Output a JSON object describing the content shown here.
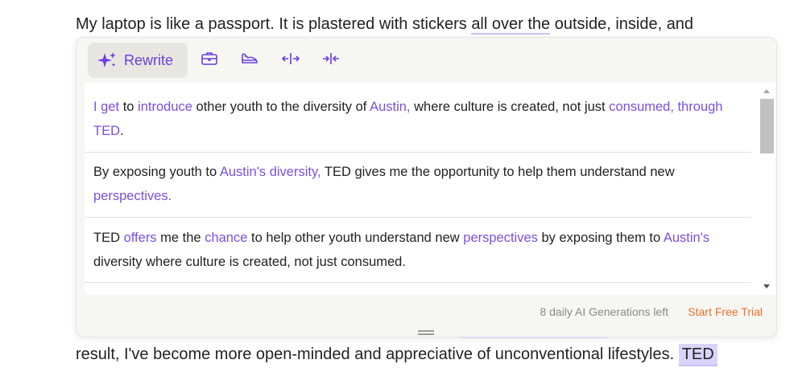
{
  "document": {
    "top_line": {
      "part1": "My laptop is like a passport. It is plastered with stickers ",
      "highlighted": "all over the",
      "part2": " outside, inside, and"
    },
    "bottom_line": {
      "part1": "result, I've become more open-minded and appreciative of unconventional lifestyles. ",
      "selected": "TED"
    }
  },
  "toolbar": {
    "rewrite_label": "Rewrite",
    "icons": [
      "sparkle-icon",
      "briefcase-icon",
      "casual-icon",
      "expand-icon",
      "shorten-icon"
    ]
  },
  "suggestions": [
    {
      "segments": [
        {
          "text": "I get",
          "hl": true
        },
        {
          "text": " to ",
          "hl": false
        },
        {
          "text": "introduce",
          "hl": true
        },
        {
          "text": " other youth to the diversity of ",
          "hl": false
        },
        {
          "text": "Austin,",
          "hl": true
        },
        {
          "text": " where culture is created, not just ",
          "hl": false
        },
        {
          "text": "consumed, through TED",
          "hl": true
        },
        {
          "text": ".",
          "hl": false
        }
      ]
    },
    {
      "segments": [
        {
          "text": "By exposing youth to ",
          "hl": false
        },
        {
          "text": "Austin's diversity,",
          "hl": true
        },
        {
          "text": " TED gives me the opportunity to help them understand new ",
          "hl": false
        },
        {
          "text": "perspectives.",
          "hl": true
        }
      ]
    },
    {
      "segments": [
        {
          "text": "TED ",
          "hl": false
        },
        {
          "text": "offers",
          "hl": true
        },
        {
          "text": " me the ",
          "hl": false
        },
        {
          "text": "chance",
          "hl": true
        },
        {
          "text": " to help other youth understand new ",
          "hl": false
        },
        {
          "text": "perspectives",
          "hl": true
        },
        {
          "text": " by exposing them to ",
          "hl": false
        },
        {
          "text": "Austin's",
          "hl": true
        },
        {
          "text": " diversity where culture is created, not just consumed.",
          "hl": false
        }
      ]
    }
  ],
  "footer": {
    "generations_left": "8 daily AI Generations left",
    "trial_label": "Start Free Trial"
  },
  "colors": {
    "accent_purple": "#7b4fe0",
    "trial_orange": "#e8702a",
    "selection_bg": "#d9d4fa"
  }
}
